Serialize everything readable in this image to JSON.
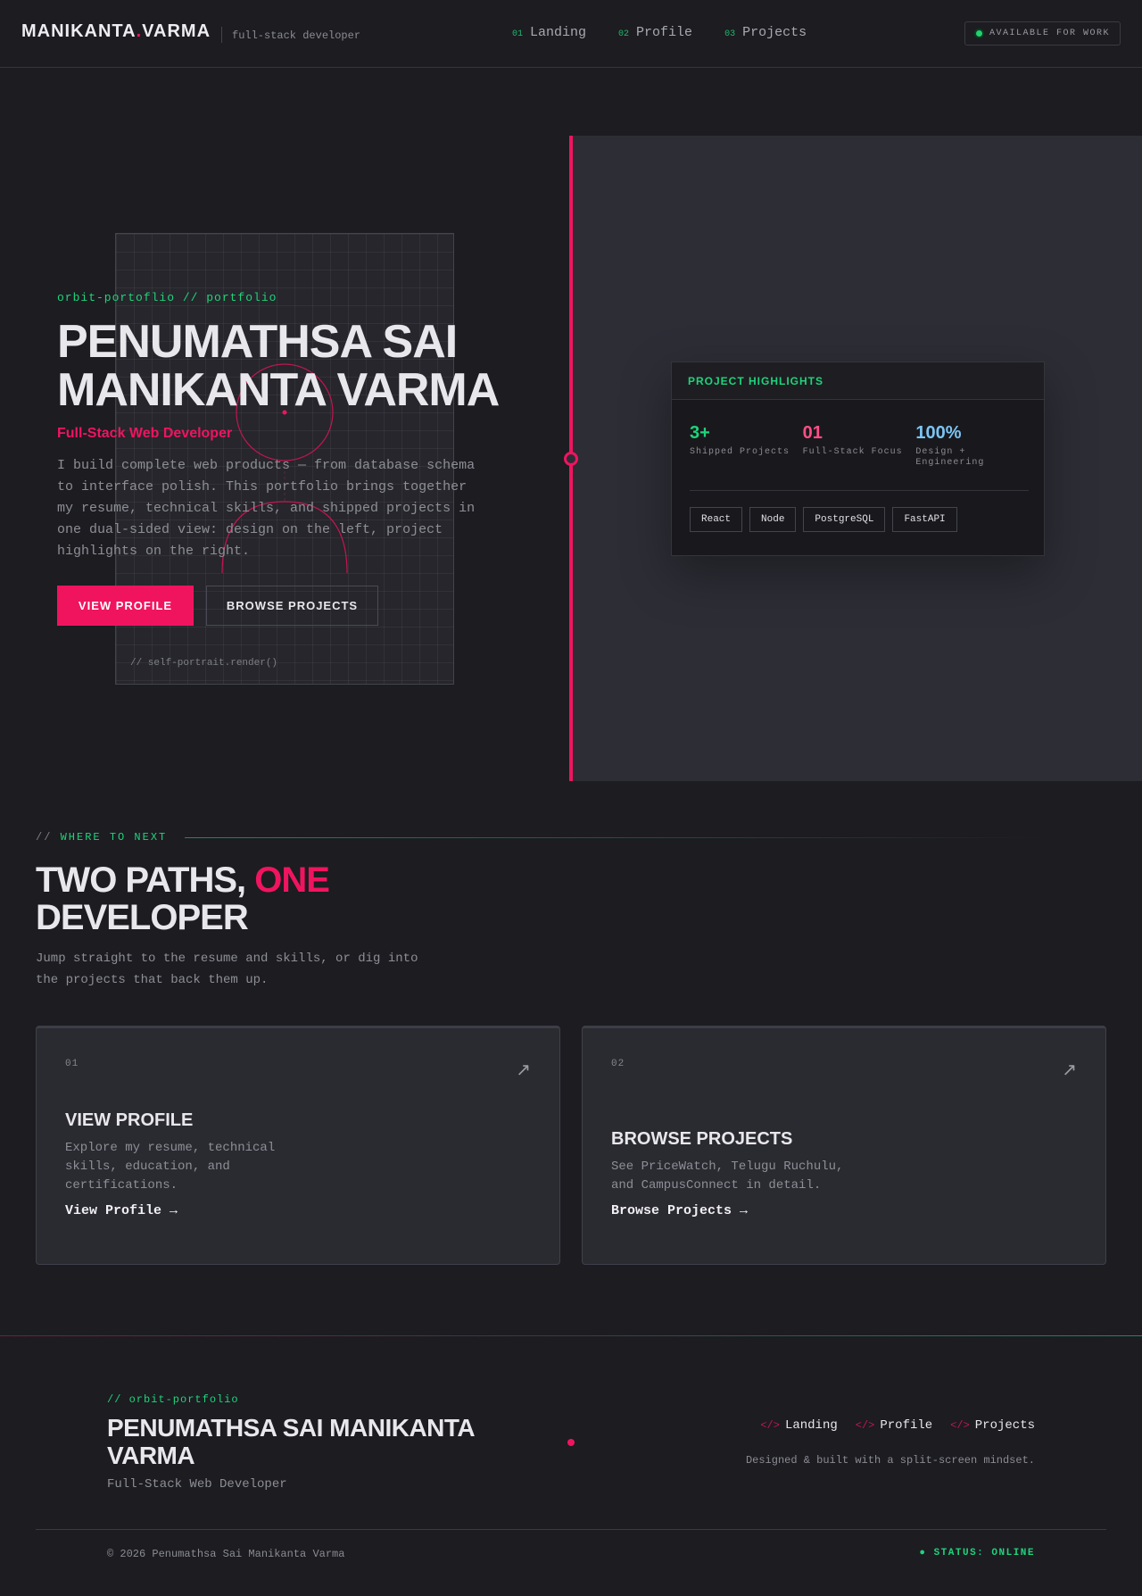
{
  "header": {
    "logo_first": "MANIKANTA",
    "logo_dot": ".",
    "logo_last": "VARMA",
    "subtitle": "full-stack developer",
    "nav": [
      {
        "num": "01",
        "label": "Landing"
      },
      {
        "num": "02",
        "label": "Profile"
      },
      {
        "num": "03",
        "label": "Projects"
      }
    ],
    "status": "AVAILABLE FOR WORK"
  },
  "hero": {
    "eyebrow": "orbit-portoflio // portfolio",
    "title": "PENUMATHSA SAI MANIKANTA VARMA",
    "role": "Full-Stack Web Developer",
    "description": "I build complete web products — from database schema to interface polish. This portfolio brings together my resume, technical skills, and shipped projects in one dual-sided view: design on the left, project highlights on the right.",
    "primary_button": "VIEW PROFILE",
    "secondary_button": "BROWSE PROJECTS",
    "portrait_caption": "// self-portrait.render()"
  },
  "highlights": {
    "title": "PROJECT HIGHLIGHTS",
    "stats": [
      {
        "value": "3+",
        "label": "Shipped Projects",
        "color": "#1fd47a"
      },
      {
        "value": "01",
        "label": "Full-Stack Focus",
        "color": "#ff4f87"
      },
      {
        "value": "100%",
        "label": "Design + Engineering",
        "color": "#7cc4f4"
      }
    ],
    "tags": [
      "React",
      "Node",
      "PostgreSQL",
      "FastAPI"
    ]
  },
  "paths": {
    "eyebrow_prefix": "//",
    "eyebrow": "WHERE TO NEXT",
    "title_a": "TWO PATHS,",
    "title_b": "ONE",
    "title_c": "DEVELOPER",
    "description": "Jump straight to the resume and skills, or dig into the projects that back them up.",
    "cards": [
      {
        "num": "01",
        "title": "VIEW PROFILE",
        "description": "Explore my resume, technical skills, education, and certifications.",
        "link": "View Profile →",
        "arrow": "↗"
      },
      {
        "num": "02",
        "title": "BROWSE PROJECTS",
        "description": "See PriceWatch, Telugu Ruchulu, and CampusConnect in detail.",
        "link": "Browse Projects →",
        "arrow": "↗"
      }
    ]
  },
  "footer": {
    "eyebrow": "// orbit-portfolio",
    "name": "PENUMATHSA SAI MANIKANTA VARMA",
    "role": "Full-Stack Web Developer",
    "nav_prefix": "</>",
    "nav": [
      "Landing",
      "Profile",
      "Projects"
    ],
    "tagline": "Designed & built with a split-screen mindset.",
    "copyright": "© 2026 Penumathsa Sai Manikanta Varma",
    "status": "● STATUS: ONLINE"
  },
  "colors": {
    "accent_pink": "#f0145f",
    "accent_green": "#1fd47a",
    "accent_blue": "#7cc4f4",
    "background": "#1c1c21",
    "panel": "#2d2d36"
  }
}
